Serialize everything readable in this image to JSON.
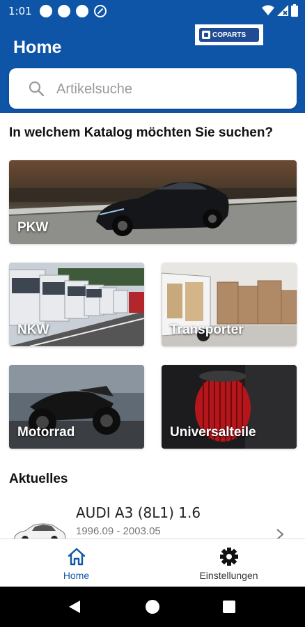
{
  "status_bar": {
    "time": "1:01"
  },
  "header": {
    "title": "Home",
    "logo_text": "COPARTS",
    "search_placeholder": "Artikelsuche"
  },
  "catalog": {
    "heading": "In welchem Katalog möchten Sie suchen?",
    "tiles": [
      {
        "label": "PKW"
      },
      {
        "label": "NKW"
      },
      {
        "label": "Transporter"
      },
      {
        "label": "Motorrad"
      },
      {
        "label": "Universalteile"
      }
    ]
  },
  "news": {
    "heading": "Aktuelles",
    "items": [
      {
        "name": "AUDI A3 (8L1) 1.6",
        "years": "1996.09 - 2003.05"
      }
    ]
  },
  "bottom_nav": {
    "items": [
      {
        "label": "Home",
        "icon": "home-icon",
        "active": true
      },
      {
        "label": "Einstellungen",
        "icon": "gear-icon",
        "active": false
      }
    ]
  },
  "colors": {
    "primary": "#0e55a7",
    "active_nav": "#0e55a7"
  }
}
